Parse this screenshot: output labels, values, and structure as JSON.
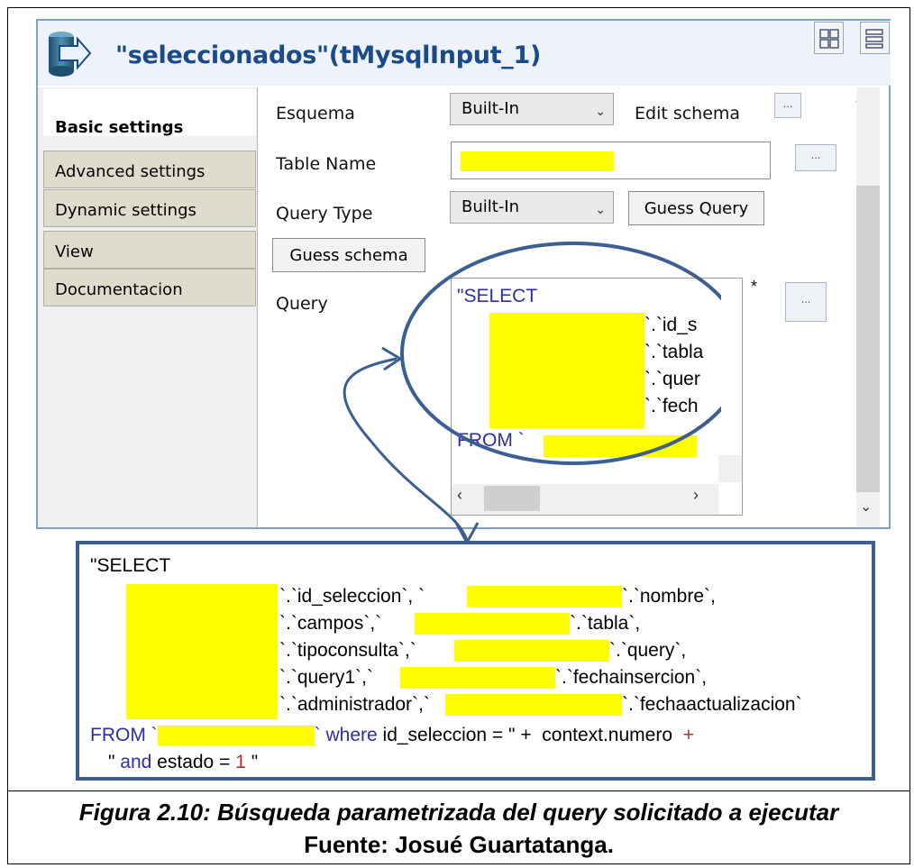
{
  "window": {
    "title": "\"seleccionados\"(tMysqlInput_1)",
    "accent_color": "#1b4a8a",
    "icon": "component-arrow-icon"
  },
  "tabs": [
    {
      "label": "Basic settings",
      "active": true
    },
    {
      "label": "Advanced settings",
      "active": false
    },
    {
      "label": "Dynamic settings",
      "active": false
    },
    {
      "label": "View",
      "active": false
    },
    {
      "label": "Documentacion",
      "active": false
    }
  ],
  "settings": {
    "schema_label": "Esquema",
    "schema_value": "Built-In",
    "edit_schema_label": "Edit schema",
    "table_name_label": "Table Name",
    "query_type_label": "Query Type",
    "query_type_value": "Built-In",
    "guess_query_label": "Guess Query",
    "guess_schema_label": "Guess schema",
    "query_label": "Query",
    "query_modified_marker": "*",
    "dots_label": "..."
  },
  "query_preview": {
    "line1": "\"SELECT",
    "lines": [
      "`.`id_s",
      "`.`tabla",
      "`.`quer",
      "`.`fech"
    ],
    "from": "FROM `"
  },
  "query_full": {
    "select": "\"SELECT",
    "rows": [
      {
        "a": "`.`id_seleccion`, `",
        "b": "`.`nombre`,"
      },
      {
        "a": "`.`campos`,`",
        "b": "`.`tabla`,"
      },
      {
        "a": "`.`tipoconsulta`,`",
        "b": "`.`query`,"
      },
      {
        "a": "`.`query1`,`",
        "b": "`.`fechainsercion`,"
      },
      {
        "a": "`.`administrador`,`",
        "b": "`.`fechaactualizacion`"
      }
    ],
    "from": "FROM `",
    "where": "` where",
    "where_rest": " id_seleccion = ",
    "quote_plus": "\" +",
    "context": "context.numero",
    "plus": "+",
    "and_quote": "\"",
    "and": " and",
    "estado": " estado = ",
    "one": "1",
    "end_quote": " \""
  },
  "caption": {
    "figure": "Figura 2.10: Búsqueda parametrizada del query solicitado a ejecutar",
    "source": "Fuente: Josué Guartatanga."
  },
  "colors": {
    "highlight": "#ffff00",
    "keyword": "#2e2ea8",
    "annotation": "#3c5f91"
  }
}
